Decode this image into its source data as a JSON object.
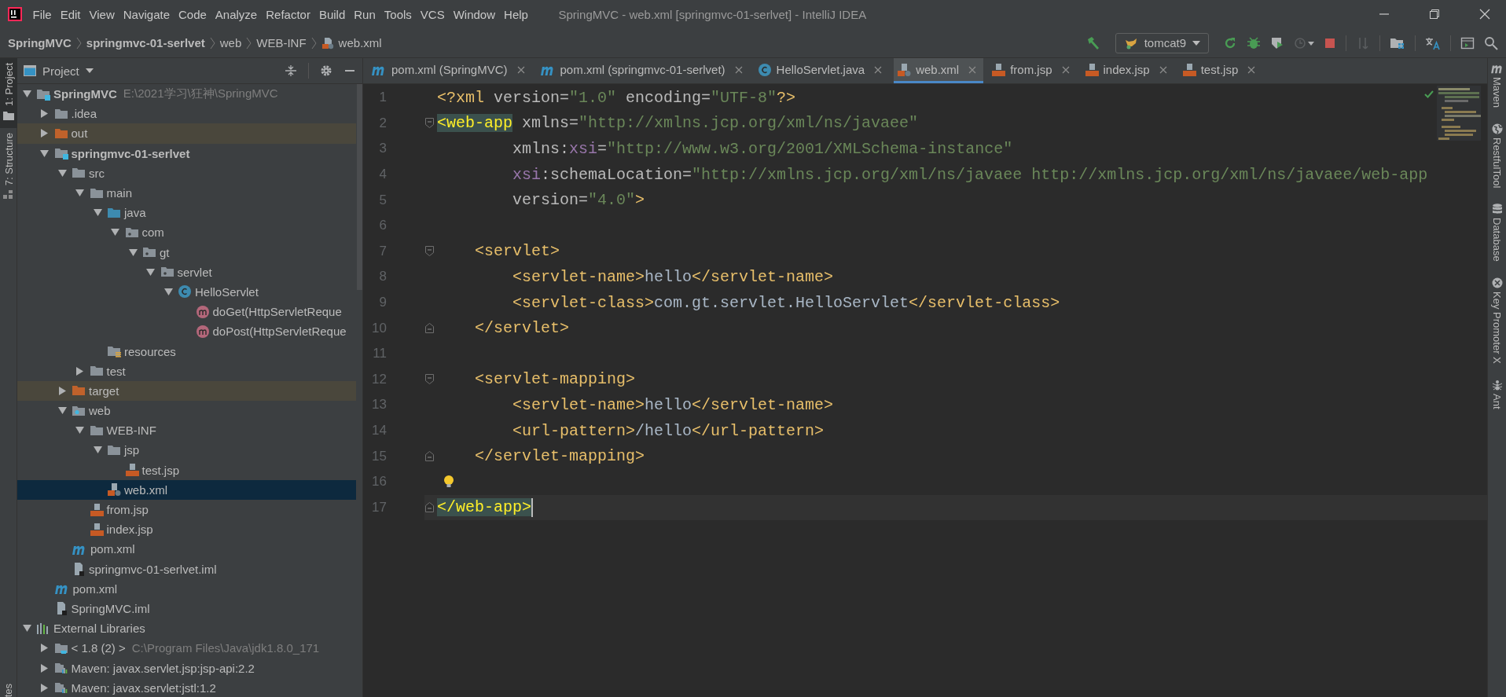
{
  "menu": [
    {
      "label": "File"
    },
    {
      "label": "Edit"
    },
    {
      "label": "View"
    },
    {
      "label": "Navigate"
    },
    {
      "label": "Code"
    },
    {
      "label": "Analyze"
    },
    {
      "label": "Refactor"
    },
    {
      "label": "Build"
    },
    {
      "label": "Run"
    },
    {
      "label": "Tools"
    },
    {
      "label": "VCS"
    },
    {
      "label": "Window"
    },
    {
      "label": "Help"
    }
  ],
  "window_title": "SpringMVC - web.xml [springmvc-01-serlvet] - IntelliJ IDEA",
  "breadcrumbs": [
    {
      "label": "SpringMVC",
      "kind": "module"
    },
    {
      "label": "springmvc-01-serlvet",
      "kind": "module"
    },
    {
      "label": "web",
      "kind": "folder"
    },
    {
      "label": "WEB-INF",
      "kind": "folder"
    },
    {
      "label": "web.xml",
      "kind": "xml"
    }
  ],
  "run_config": "tomcat9",
  "left_tool_tabs": [
    {
      "label": "1: Project",
      "kind": "project",
      "selected": true
    },
    {
      "label": "7: Structure",
      "kind": "structure",
      "selected": false
    }
  ],
  "bottom_left_tab": "tes",
  "project_panel": {
    "title": "Project",
    "tree": [
      {
        "label": "SpringMVC",
        "hint": "E:\\2021学习\\狂神\\SpringMVC",
        "kind": "module",
        "expanded": true,
        "selected": false,
        "excluded": false,
        "children": [
          {
            "label": ".idea",
            "kind": "folder",
            "expanded": false,
            "selected": false,
            "excluded": false
          },
          {
            "label": "out",
            "kind": "folder",
            "expanded": false,
            "selected": false,
            "excluded": true
          },
          {
            "label": "springmvc-01-serlvet",
            "kind": "module",
            "expanded": true,
            "selected": false,
            "excluded": false,
            "children": [
              {
                "label": "src",
                "kind": "folder",
                "expanded": true,
                "selected": false,
                "excluded": false,
                "children": [
                  {
                    "label": "main",
                    "kind": "folder",
                    "expanded": true,
                    "selected": false,
                    "excluded": false,
                    "children": [
                      {
                        "label": "java",
                        "kind": "source-folder",
                        "expanded": true,
                        "selected": false,
                        "excluded": false,
                        "children": [
                          {
                            "label": "com",
                            "kind": "package",
                            "expanded": true,
                            "selected": false,
                            "excluded": false,
                            "children": [
                              {
                                "label": "gt",
                                "kind": "package",
                                "expanded": true,
                                "selected": false,
                                "excluded": false,
                                "children": [
                                  {
                                    "label": "servlet",
                                    "kind": "package",
                                    "expanded": true,
                                    "selected": false,
                                    "excluded": false,
                                    "children": [
                                      {
                                        "label": "HelloServlet",
                                        "kind": "class",
                                        "expanded": true,
                                        "selected": false,
                                        "excluded": false,
                                        "children": [
                                          {
                                            "label": "doGet(HttpServletReque",
                                            "kind": "method",
                                            "selected": false,
                                            "excluded": false
                                          },
                                          {
                                            "label": "doPost(HttpServletReque",
                                            "kind": "method",
                                            "selected": false,
                                            "excluded": false
                                          }
                                        ]
                                      }
                                    ]
                                  }
                                ]
                              }
                            ]
                          }
                        ]
                      },
                      {
                        "label": "resources",
                        "kind": "resources",
                        "selected": false,
                        "excluded": false
                      }
                    ]
                  },
                  {
                    "label": "test",
                    "kind": "folder",
                    "expanded": false,
                    "selected": false,
                    "excluded": false
                  }
                ]
              },
              {
                "label": "target",
                "kind": "folder",
                "expanded": false,
                "selected": false,
                "excluded": true
              },
              {
                "label": "web",
                "kind": "web-folder",
                "expanded": true,
                "selected": false,
                "excluded": false,
                "children": [
                  {
                    "label": "WEB-INF",
                    "kind": "folder",
                    "expanded": true,
                    "selected": false,
                    "excluded": false,
                    "children": [
                      {
                        "label": "jsp",
                        "kind": "folder",
                        "expanded": true,
                        "selected": false,
                        "excluded": false,
                        "children": [
                          {
                            "label": "test.jsp",
                            "kind": "jsp",
                            "selected": false,
                            "excluded": false
                          }
                        ]
                      },
                      {
                        "label": "web.xml",
                        "kind": "xml",
                        "selected": true,
                        "excluded": false
                      }
                    ]
                  },
                  {
                    "label": "from.jsp",
                    "kind": "jsp",
                    "selected": false,
                    "excluded": false
                  },
                  {
                    "label": "index.jsp",
                    "kind": "jsp",
                    "selected": false,
                    "excluded": false
                  }
                ]
              },
              {
                "label": "pom.xml",
                "kind": "maven",
                "selected": false,
                "excluded": false
              },
              {
                "label": "springmvc-01-serlvet.iml",
                "kind": "iml",
                "selected": false,
                "excluded": false
              }
            ]
          },
          {
            "label": "pom.xml",
            "kind": "maven",
            "selected": false,
            "excluded": false
          },
          {
            "label": "SpringMVC.iml",
            "kind": "iml",
            "selected": false,
            "excluded": false
          }
        ]
      },
      {
        "label": "External Libraries",
        "kind": "libraries",
        "expanded": true,
        "selected": false,
        "excluded": false,
        "children": [
          {
            "label": "< 1.8 (2) >",
            "hint": "C:\\Program Files\\Java\\jdk1.8.0_171",
            "kind": "jdk",
            "expanded": false,
            "selected": false,
            "excluded": false
          },
          {
            "label": "Maven: javax.servlet.jsp:jsp-api:2.2",
            "kind": "library",
            "expanded": false,
            "selected": false,
            "excluded": false
          },
          {
            "label": "Maven: javax.servlet:jstl:1.2",
            "kind": "library",
            "expanded": false,
            "selected": false,
            "excluded": false
          }
        ]
      }
    ]
  },
  "tabs": [
    {
      "label": "pom.xml (SpringMVC)",
      "kind": "maven",
      "selected": false
    },
    {
      "label": "pom.xml (springmvc-01-serlvet)",
      "kind": "maven",
      "selected": false
    },
    {
      "label": "HelloServlet.java",
      "kind": "class",
      "selected": false
    },
    {
      "label": "web.xml",
      "kind": "xml",
      "selected": true
    },
    {
      "label": "from.jsp",
      "kind": "jsp",
      "selected": false
    },
    {
      "label": "index.jsp",
      "kind": "jsp",
      "selected": false
    },
    {
      "label": "test.jsp",
      "kind": "jsp",
      "selected": false
    }
  ],
  "editor": {
    "lines": [
      {
        "number": "1",
        "current": false,
        "tokens": [
          {
            "kind": "tag",
            "text": "<?xml "
          },
          {
            "kind": "attr",
            "text": "version="
          },
          {
            "kind": "value",
            "text": "\"1.0\""
          },
          {
            "kind": "attr",
            "text": " encoding="
          },
          {
            "kind": "value",
            "text": "\"UTF-8\""
          },
          {
            "kind": "tag",
            "text": "?>"
          }
        ]
      },
      {
        "number": "2",
        "current": false,
        "fold_start": true,
        "tokens": [
          {
            "kind": "matched-tag",
            "text": "<web-app"
          },
          {
            "kind": "attr",
            "text": " xmlns="
          },
          {
            "kind": "value",
            "text": "\"http://xmlns.jcp.org/xml/ns/javaee\""
          }
        ]
      },
      {
        "number": "3",
        "current": false,
        "tokens": [
          {
            "kind": "attr",
            "text": "        xmlns:"
          },
          {
            "kind": "ns",
            "text": "xsi"
          },
          {
            "kind": "attr",
            "text": "="
          },
          {
            "kind": "value",
            "text": "\"http://www.w3.org/2001/XMLSchema-instance\""
          }
        ]
      },
      {
        "number": "4",
        "current": false,
        "tokens": [
          {
            "kind": "ns",
            "text": "        xsi"
          },
          {
            "kind": "attr",
            "text": ":schemaLocation="
          },
          {
            "kind": "value",
            "text": "\"http://xmlns.jcp.org/xml/ns/javaee http://xmlns.jcp.org/xml/ns/javaee/web-app"
          }
        ]
      },
      {
        "number": "5",
        "current": false,
        "tokens": [
          {
            "kind": "attr",
            "text": "        version="
          },
          {
            "kind": "value",
            "text": "\"4.0\""
          },
          {
            "kind": "tag",
            "text": ">"
          }
        ]
      },
      {
        "number": "6",
        "current": false
      },
      {
        "number": "7",
        "current": false,
        "fold_start": true,
        "tokens": [
          {
            "kind": "tag",
            "text": "    <servlet>"
          }
        ]
      },
      {
        "number": "8",
        "current": false,
        "tokens": [
          {
            "kind": "tag",
            "text": "        <servlet-name>"
          },
          {
            "kind": "text",
            "text": "hello"
          },
          {
            "kind": "tag",
            "text": "</servlet-name>"
          }
        ]
      },
      {
        "number": "9",
        "current": false,
        "tokens": [
          {
            "kind": "tag",
            "text": "        <servlet-class>"
          },
          {
            "kind": "text",
            "text": "com.gt.servlet.HelloServlet"
          },
          {
            "kind": "tag",
            "text": "</servlet-class>"
          }
        ]
      },
      {
        "number": "10",
        "current": false,
        "fold_end": true,
        "tokens": [
          {
            "kind": "tag",
            "text": "    </servlet>"
          }
        ]
      },
      {
        "number": "11",
        "current": false
      },
      {
        "number": "12",
        "current": false,
        "fold_start": true,
        "tokens": [
          {
            "kind": "tag",
            "text": "    <servlet-mapping>"
          }
        ]
      },
      {
        "number": "13",
        "current": false,
        "tokens": [
          {
            "kind": "tag",
            "text": "        <servlet-name>"
          },
          {
            "kind": "text",
            "text": "hello"
          },
          {
            "kind": "tag",
            "text": "</servlet-name>"
          }
        ]
      },
      {
        "number": "14",
        "current": false,
        "tokens": [
          {
            "kind": "tag",
            "text": "        <url-pattern>"
          },
          {
            "kind": "text",
            "text": "/hello"
          },
          {
            "kind": "tag",
            "text": "</url-pattern>"
          }
        ]
      },
      {
        "number": "15",
        "current": false,
        "fold_end": true,
        "tokens": [
          {
            "kind": "tag",
            "text": "    </servlet-mapping>"
          }
        ]
      },
      {
        "number": "16",
        "current": false,
        "bulb": true
      },
      {
        "number": "17",
        "current": true,
        "fold_end": true,
        "tokens": [
          {
            "kind": "matched-tag",
            "text": "</web-app>"
          }
        ]
      }
    ]
  },
  "right_tool_tabs": [
    {
      "label": "Maven",
      "kind": "maven"
    },
    {
      "label": "RestfulTool",
      "kind": "globe"
    },
    {
      "label": "Database",
      "kind": "database"
    },
    {
      "label": "Key Promoter X",
      "kind": "keypromoter"
    },
    {
      "label": "Ant",
      "kind": "ant"
    }
  ]
}
